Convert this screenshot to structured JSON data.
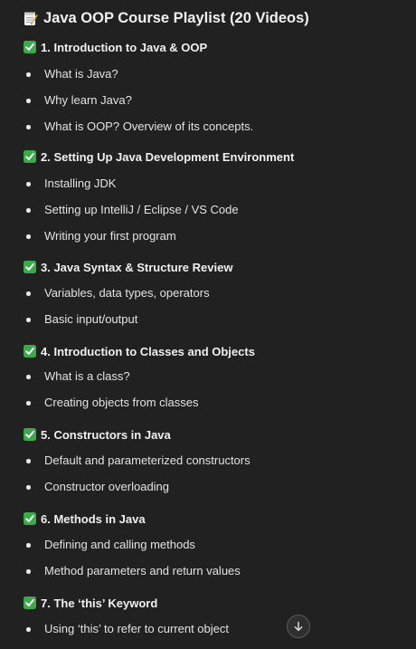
{
  "title": "Java OOP Course Playlist (20 Videos)",
  "title_icon": "memo-icon",
  "check_icon": "white-heavy-check-mark",
  "sections": [
    {
      "heading": "1. Introduction to Java & OOP",
      "items": [
        "What is Java?",
        "Why learn Java?",
        "What is OOP? Overview of its concepts."
      ]
    },
    {
      "heading": "2. Setting Up Java Development Environment",
      "items": [
        "Installing JDK",
        "Setting up IntelliJ / Eclipse / VS Code",
        "Writing your first program"
      ]
    },
    {
      "heading": "3. Java Syntax & Structure Review",
      "items": [
        "Variables, data types, operators",
        "Basic input/output"
      ]
    },
    {
      "heading": "4. Introduction to Classes and Objects",
      "items": [
        "What is a class?",
        "Creating objects from classes"
      ]
    },
    {
      "heading": "5. Constructors in Java",
      "items": [
        "Default and parameterized constructors",
        "Constructor overloading"
      ]
    },
    {
      "heading": "6. Methods in Java",
      "items": [
        "Defining and calling methods",
        "Method parameters and return values"
      ]
    },
    {
      "heading": "7. The ‘this’ Keyword",
      "items": [
        "Using ‘this’ to refer to current object"
      ]
    }
  ],
  "scroll_button_icon": "arrow-down-icon",
  "colors": {
    "background": "#212121",
    "text": "#ececec",
    "check_green": "#3bab4a"
  }
}
